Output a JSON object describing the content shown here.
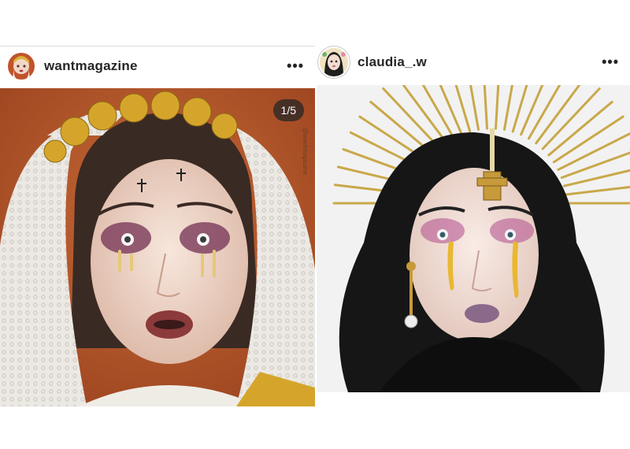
{
  "posts": [
    {
      "username": "wantmagazine",
      "more_label": "•••",
      "carousel_counter": "1/5",
      "watermark": "@wantmagazine"
    },
    {
      "username": "claudia_.w",
      "more_label": "•••"
    }
  ],
  "icons": {
    "more": "more-options-icon"
  },
  "colors": {
    "text": "#262626",
    "divider": "#dbdbdb",
    "left_bg": "#b4552a",
    "right_bg": "#f2f2f2"
  }
}
